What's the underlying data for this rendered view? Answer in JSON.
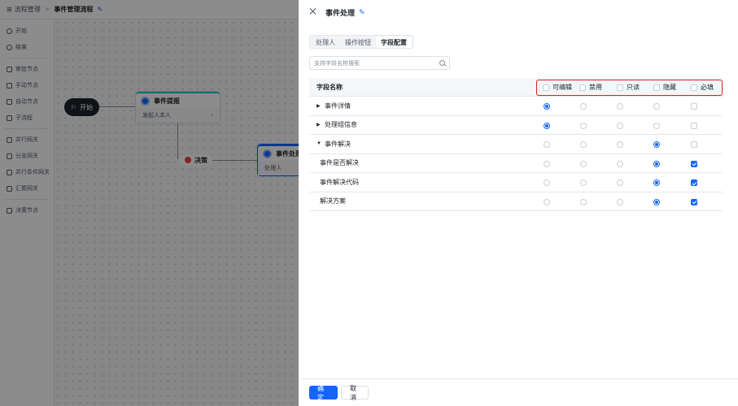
{
  "breadcrumb": {
    "root": "流程管理",
    "separator": ">",
    "title": "事件管理流程"
  },
  "left_panel": {
    "items": [
      "开始",
      "结束",
      "审批节点",
      "手动节点",
      "自动节点",
      "子流程",
      "并行网关",
      "分支网关",
      "并行条件网关",
      "汇聚网关",
      "决策节点"
    ]
  },
  "canvas": {
    "start_label": "开始",
    "node1": {
      "title": "事件提报",
      "sub": "发起人本人"
    },
    "decision_label": "决策",
    "node2": {
      "title": "事件处理",
      "sub": "处理人"
    }
  },
  "drawer": {
    "title": "事件处理",
    "tabs": [
      {
        "label": "处理人",
        "active": false
      },
      {
        "label": "操作按钮",
        "active": false
      },
      {
        "label": "字段配置",
        "active": true
      }
    ],
    "search_placeholder": "支持字段名称搜索",
    "table": {
      "name_header": "字段名称",
      "columns": [
        "可编辑",
        "禁用",
        "只读",
        "隐藏",
        "必填"
      ],
      "rows": [
        {
          "label": "事件详情",
          "expand": "collapsed",
          "child": false,
          "selected": 0,
          "required": false
        },
        {
          "label": "处理组信息",
          "expand": "collapsed",
          "child": false,
          "selected": 0,
          "required": false
        },
        {
          "label": "事件解决",
          "expand": "expanded",
          "child": false,
          "selected": 3,
          "required": false
        },
        {
          "label": "事件是否解决",
          "expand": "none",
          "child": true,
          "selected": 3,
          "required": true
        },
        {
          "label": "事件解决代码",
          "expand": "none",
          "child": true,
          "selected": 3,
          "required": true
        },
        {
          "label": "解决方案",
          "expand": "none",
          "child": true,
          "selected": 3,
          "required": true
        }
      ]
    },
    "confirm_label": "确定",
    "cancel_label": "取消"
  },
  "colors": {
    "primary": "#1664ff",
    "highlight_border": "#e02020"
  }
}
